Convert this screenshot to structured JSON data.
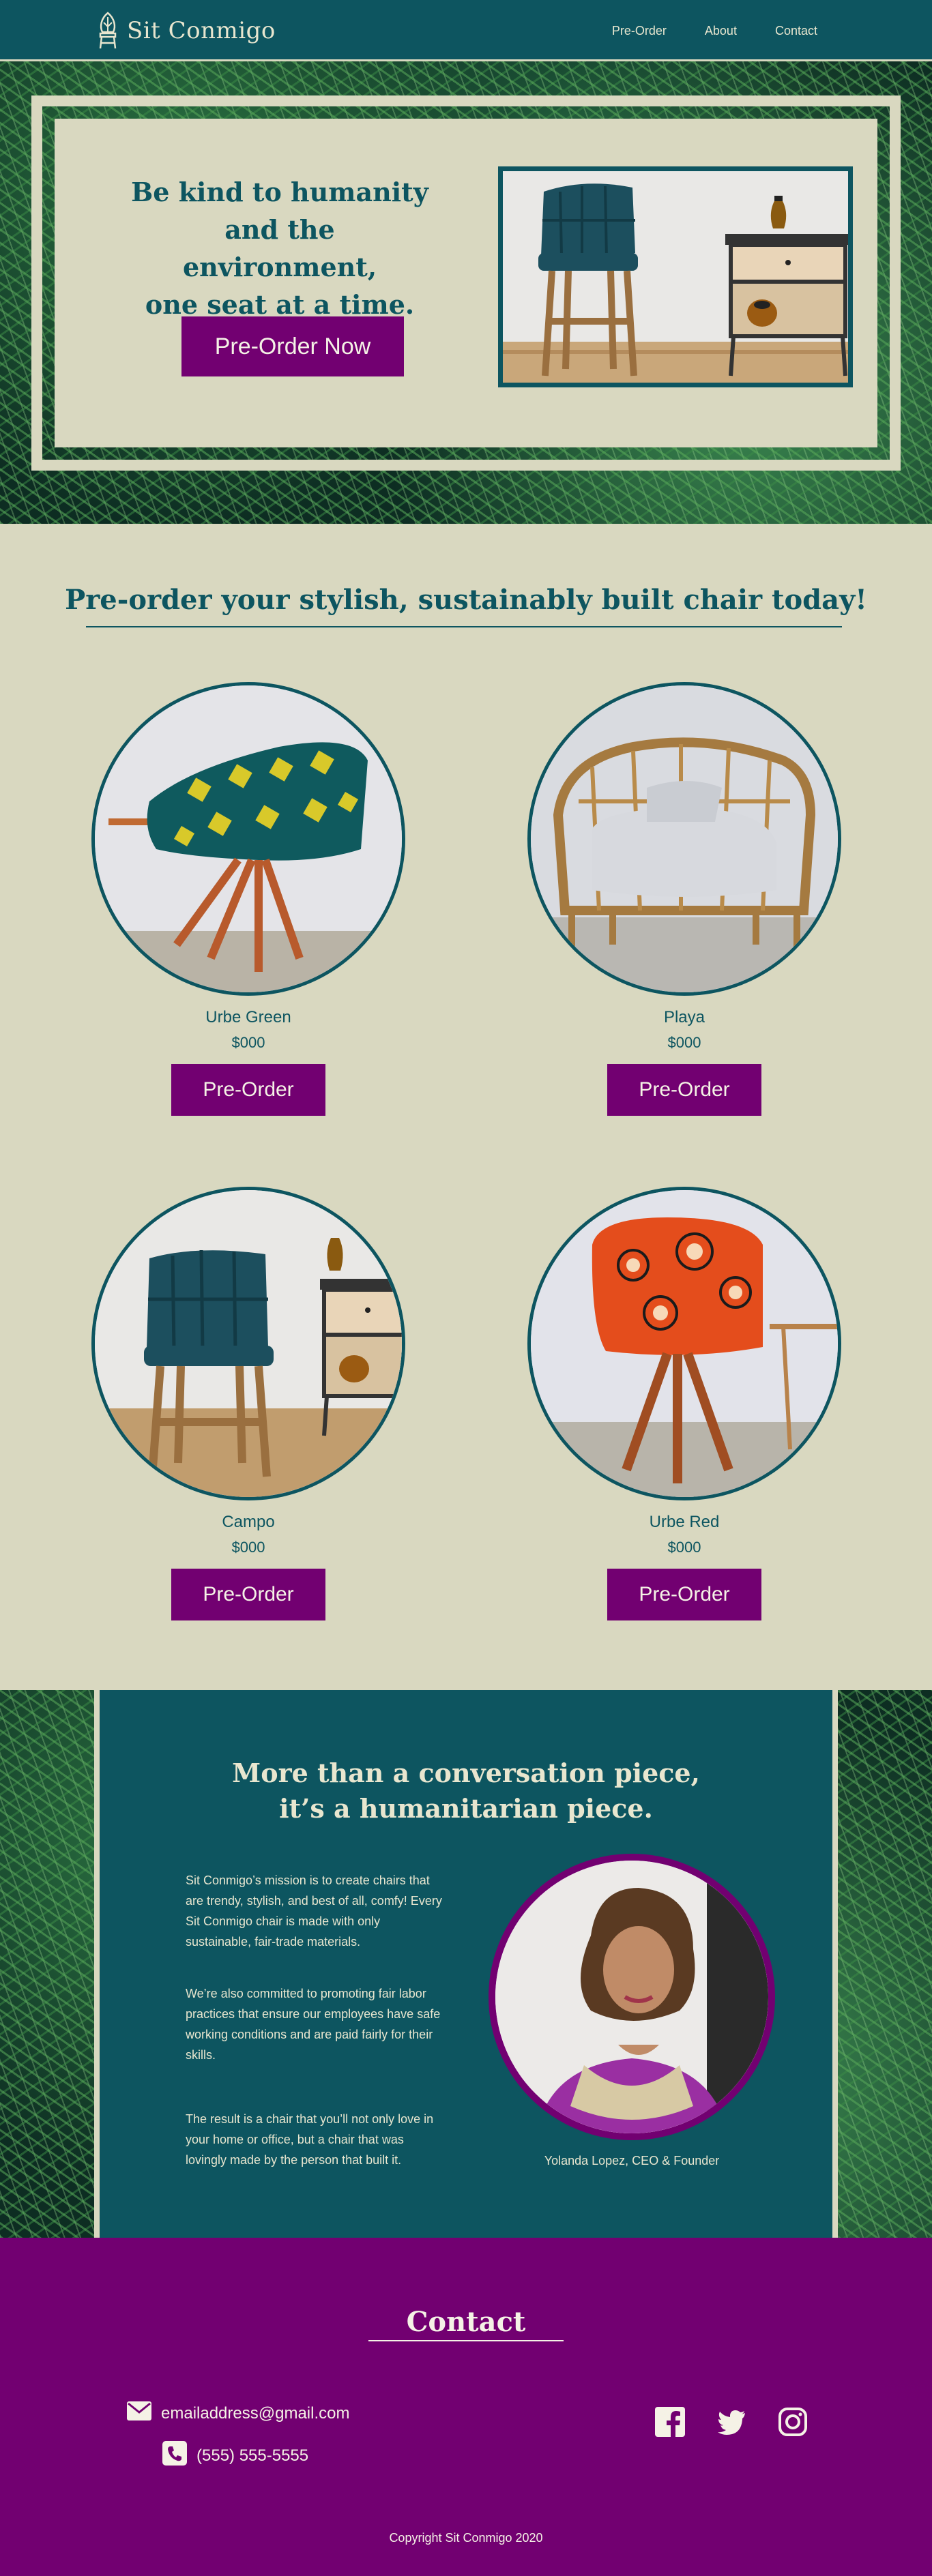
{
  "nav": {
    "brand": "Sit Conmigo",
    "links": [
      "Pre-Order",
      "About",
      "Contact"
    ]
  },
  "hero": {
    "title_lines": [
      "Be kind to humanity",
      "and the environment,",
      "one seat at a time."
    ],
    "button": "Pre-Order Now"
  },
  "products": {
    "title": "Pre-order your stylish, sustainably built chair today!",
    "items": [
      {
        "name": "Urbe Green",
        "price": "$000",
        "button": "Pre-Order"
      },
      {
        "name": "Playa",
        "price": "$000",
        "button": "Pre-Order"
      },
      {
        "name": "Campo",
        "price": "$000",
        "button": "Pre-Order"
      },
      {
        "name": "Urbe Red",
        "price": "$000",
        "button": "Pre-Order"
      }
    ]
  },
  "mission": {
    "title_lines": [
      "More than a conversation piece,",
      "it’s a humanitarian piece."
    ],
    "paragraphs": [
      "Sit Conmigo’s mission is to create chairs that are trendy, stylish, and best of all, comfy! Every Sit Conmigo chair is made with only sustainable, fair-trade materials.",
      "We’re also committed to promoting fair labor practices that ensure our employees have safe working conditions and are paid fairly for their skills.",
      "The result is a chair that you’ll not only love in your home or office, but a chair that was lovingly made by the person that built it."
    ],
    "ceo_caption": "Yolanda Lopez, CEO & Founder"
  },
  "contact": {
    "title": "Contact",
    "email": "emailaddress@gmail.com",
    "phone": "(555) 555-5555",
    "copyright": "Copyright Sit Conmigo 2020"
  },
  "colors": {
    "teal": "#0d5560",
    "purple": "#720071",
    "cream": "#d9d8c0"
  },
  "icons": [
    "chair-logo-icon",
    "envelope-icon",
    "phone-icon",
    "facebook-icon",
    "twitter-icon",
    "instagram-icon"
  ]
}
